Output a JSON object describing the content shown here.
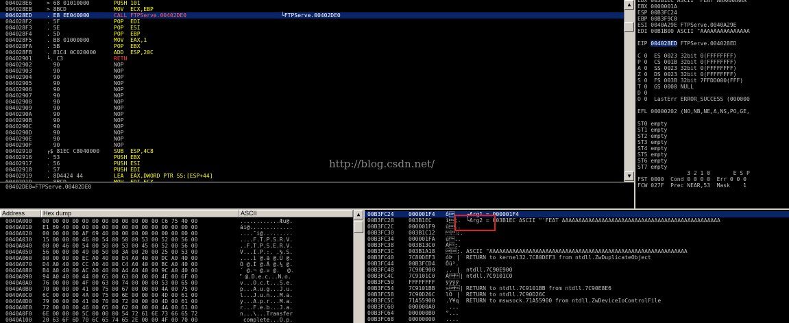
{
  "disassembly": {
    "rows": [
      {
        "addr": "004028E6",
        "gut": " ",
        "hex": "> 68 01010000",
        "op": "PUSH",
        "args": "101",
        "cls": "k-push",
        "cmt": ""
      },
      {
        "addr": "004028EB",
        "gut": " ",
        "hex": "> 8BCD",
        "op": "MOV",
        "args": "ECX,EBP",
        "cls": "k-mov",
        "cmt": ""
      },
      {
        "addr": "004028ED",
        "gut": " ",
        "hex": ". E8 EE040000",
        "op": "CALL",
        "args": "FTPServe.00402DE0",
        "cls": "k-call",
        "cmt": "└FTPServe.00402DE0",
        "sel": true
      },
      {
        "addr": "004028F2",
        "gut": " ",
        "hex": ". 5F",
        "op": "POP",
        "args": "EDI",
        "cls": "k-pop",
        "cmt": ""
      },
      {
        "addr": "004028F3",
        "gut": " ",
        "hex": ". 5E",
        "op": "POP",
        "args": "ESI",
        "cls": "k-pop",
        "cmt": ""
      },
      {
        "addr": "004028F4",
        "gut": " ",
        "hex": ". 5D",
        "op": "POP",
        "args": "EBP",
        "cls": "k-pop",
        "cmt": ""
      },
      {
        "addr": "004028F5",
        "gut": " ",
        "hex": ". B8 01000000",
        "op": "MOV",
        "args": "EAX,1",
        "cls": "k-mov",
        "cmt": ""
      },
      {
        "addr": "004028FA",
        "gut": " ",
        "hex": ". 5B",
        "op": "POP",
        "args": "EBX",
        "cls": "k-pop",
        "cmt": ""
      },
      {
        "addr": "004028FB",
        "gut": " ",
        "hex": ". 81C4 0C020000",
        "op": "ADD",
        "args": "ESP,20C",
        "cls": "k-add",
        "cmt": ""
      },
      {
        "addr": "00402901",
        "gut": " ",
        "hex": "└. C3",
        "op": "RETN",
        "args": "",
        "cls": "k-retn",
        "cmt": ""
      },
      {
        "addr": "00402902",
        "gut": " ",
        "hex": "  90",
        "op": "NOP",
        "args": "",
        "cls": "k-nop",
        "cmt": ""
      },
      {
        "addr": "00402903",
        "gut": " ",
        "hex": "  90",
        "op": "NOP",
        "args": "",
        "cls": "k-nop",
        "cmt": ""
      },
      {
        "addr": "00402904",
        "gut": " ",
        "hex": "  90",
        "op": "NOP",
        "args": "",
        "cls": "k-nop",
        "cmt": ""
      },
      {
        "addr": "00402905",
        "gut": " ",
        "hex": "  90",
        "op": "NOP",
        "args": "",
        "cls": "k-nop",
        "cmt": ""
      },
      {
        "addr": "00402906",
        "gut": " ",
        "hex": "  90",
        "op": "NOP",
        "args": "",
        "cls": "k-nop",
        "cmt": ""
      },
      {
        "addr": "00402907",
        "gut": " ",
        "hex": "  90",
        "op": "NOP",
        "args": "",
        "cls": "k-nop",
        "cmt": ""
      },
      {
        "addr": "00402908",
        "gut": " ",
        "hex": "  90",
        "op": "NOP",
        "args": "",
        "cls": "k-nop",
        "cmt": ""
      },
      {
        "addr": "00402909",
        "gut": " ",
        "hex": "  90",
        "op": "NOP",
        "args": "",
        "cls": "k-nop",
        "cmt": ""
      },
      {
        "addr": "0040290A",
        "gut": " ",
        "hex": "  90",
        "op": "NOP",
        "args": "",
        "cls": "k-nop",
        "cmt": ""
      },
      {
        "addr": "0040290B",
        "gut": " ",
        "hex": "  90",
        "op": "NOP",
        "args": "",
        "cls": "k-nop",
        "cmt": ""
      },
      {
        "addr": "0040290C",
        "gut": " ",
        "hex": "  90",
        "op": "NOP",
        "args": "",
        "cls": "k-nop",
        "cmt": ""
      },
      {
        "addr": "0040290D",
        "gut": " ",
        "hex": "  90",
        "op": "NOP",
        "args": "",
        "cls": "k-nop",
        "cmt": ""
      },
      {
        "addr": "0040290E",
        "gut": " ",
        "hex": "  90",
        "op": "NOP",
        "args": "",
        "cls": "k-nop",
        "cmt": ""
      },
      {
        "addr": "0040290F",
        "gut": " ",
        "hex": "  90",
        "op": "NOP",
        "args": "",
        "cls": "k-nop",
        "cmt": ""
      },
      {
        "addr": "00402910",
        "gut": " ",
        "hex": "┌$ 81EC C8040000",
        "op": "SUB",
        "args": "ESP,4C8",
        "cls": "k-sub",
        "cmt": ""
      },
      {
        "addr": "00402916",
        "gut": " ",
        "hex": ". 53",
        "op": "PUSH",
        "args": "EBX",
        "cls": "k-push",
        "cmt": ""
      },
      {
        "addr": "00402917",
        "gut": " ",
        "hex": ". 56",
        "op": "PUSH",
        "args": "ESI",
        "cls": "k-push",
        "cmt": ""
      },
      {
        "addr": "00402918",
        "gut": " ",
        "hex": ". 57",
        "op": "PUSH",
        "args": "EDI",
        "cls": "k-push",
        "cmt": ""
      },
      {
        "addr": "00402919",
        "gut": " ",
        "hex": ". 8D4424 44",
        "op": "LEA",
        "args": "EAX,DWORD PTR SS:[ESP+44]",
        "cls": "k-lea",
        "cmt": ""
      },
      {
        "addr": "0040291D",
        "gut": " ",
        "hex": ". 8BCD",
        "op": "MOV",
        "args": "EDI,ECX",
        "cls": "k-mov",
        "cmt": ""
      }
    ]
  },
  "info_line": "00402DE0=FTPServe.00402DE0",
  "registers": {
    "lines": [
      {
        "t": "EDX 003B1EC ASCII \"FEAT AAAAAAAAA"
      },
      {
        "t": "EBX 0000001A"
      },
      {
        "t": "ESP 00B3FC24"
      },
      {
        "t": "EBP 00B3F9C0"
      },
      {
        "t": "ESI 0040A29E FTPServe.0040A29E"
      },
      {
        "t": "EDI 00B1B00 ASCII \"AAAAAAAAAAAAAAA"
      },
      {
        "t": ""
      },
      {
        "t": "EIP 004028ED FTPServe.004028ED",
        "hl": "EIP"
      },
      {
        "t": ""
      },
      {
        "t": "C 0  ES 0023 32bit 0(FFFFFFFF)"
      },
      {
        "t": "P 0  CS 001B 32bit 0(FFFFFFFF)"
      },
      {
        "t": "A 0  SS 0023 32bit 0(FFFFFFFF)"
      },
      {
        "t": "Z 0  DS 0023 32bit 0(FFFFFFFF)"
      },
      {
        "t": "S 0  FS 003B 32bit 7FFDD000(FFF)"
      },
      {
        "t": "T 0  GS 0000 NULL"
      },
      {
        "t": "D 0"
      },
      {
        "t": "O 0  LastErr ERROR_SUCCESS (000000"
      },
      {
        "t": ""
      },
      {
        "t": "EFL 00000202 (NO,NB,NE,A,NS,PO,GE,"
      },
      {
        "t": ""
      },
      {
        "t": "ST0 empty"
      },
      {
        "t": "ST1 empty"
      },
      {
        "t": "ST2 empty"
      },
      {
        "t": "ST3 empty"
      },
      {
        "t": "ST4 empty"
      },
      {
        "t": "ST5 empty"
      },
      {
        "t": "ST6 empty"
      },
      {
        "t": "ST7 empty"
      },
      {
        "t": "               3 2 1 0       E S P"
      },
      {
        "t": "FST 0000  Cond 0 0 0 0  Err 0 0 0"
      },
      {
        "t": "FCW 027F  Prec NEAR,53  Mask    1"
      }
    ]
  },
  "dump": {
    "headers": {
      "address": "Address",
      "hex": "Hex dump",
      "ascii": "ASCII"
    },
    "rows": [
      {
        "a": "0040A000",
        "h": "00 00 00 00 00 00 00 00 00 00 00 00 C6 75 40 00",
        "s": "............Æu@."
      },
      {
        "a": "0040A010",
        "h": "E1 69 40 00 00 00 00 00 00 00 00 00 00 00 00 00",
        "s": "ái@............."
      },
      {
        "a": "0040A020",
        "h": "00 00 00 00 AF 69 40 00 00 00 00 00 00 00 00 00",
        "s": "....¯i@........."
      },
      {
        "a": "0040A030",
        "h": "15 00 00 00 46 00 54 00 50 00 53 00 52 00 56 00",
        "s": "....F.T.P.S.R.V."
      },
      {
        "a": "0040A040",
        "h": "00 00 46 00 54 00 50 00 53 00 45 00 52 00 56 00",
        "s": "..F.T.P.S.E.R.V."
      },
      {
        "a": "0040A050",
        "h": "56 00 00 00 49 00 50 00 3A 00 20 00 25 00 53 00",
        "s": "V...I.P.:. .%.S."
      },
      {
        "a": "0040A060",
        "h": "00 00 00 00 EC A0 40 00 E4 A0 40 00 DC A0 40 00",
        "s": "....ì @.ä @.Ü @."
      },
      {
        "a": "0040A070",
        "h": "D4 A0 40 00 CC A0 40 00 C4 A0 40 00 BC A0 40 00",
        "s": "Ô @.Ì @.Ä @.¼ @."
      },
      {
        "a": "0040A080",
        "h": "B4 A0 40 00 AC A0 40 00 A4 A0 40 00 9C A0 40 00",
        "s": "´ @.¬ @.¤ @. @."
      },
      {
        "a": "0040A090",
        "h": "94 A0 40 00 44 00 65 00 63 00 00 00 4E 00 6F 00",
        "s": " @.D.e.c...N.o."
      },
      {
        "a": "0040A0A0",
        "h": "76 00 00 00 4F 00 63 00 74 00 00 00 53 00 65 00",
        "s": "v...O.c.t...S.e."
      },
      {
        "a": "0040A0B0",
        "h": "70 00 00 00 41 00 75 00 67 00 00 00 4A 00 75 00",
        "s": "p...A.u.g...J.u."
      },
      {
        "a": "0040A0C0",
        "h": "6C 00 00 00 4A 00 75 00 6E 00 00 00 4D 00 61 00",
        "s": "l...J.u.n...M.a."
      },
      {
        "a": "0040A0D0",
        "h": "79 00 00 00 41 00 70 00 72 00 00 00 4D 00 61 00",
        "s": "y...A.p.r...M.a."
      },
      {
        "a": "0040A0E0",
        "h": "72 00 00 00 46 00 65 00 62 00 00 00 4A 00 61 00",
        "s": "r...F.e.b...J.a."
      },
      {
        "a": "0040A0F0",
        "h": "6E 00 00 00 5C 00 00 00 54 72 61 6E 73 66 65 72",
        "s": "n...\\...Transfer"
      },
      {
        "a": "0040A100",
        "h": "20 63 6F 6D 70 6C 65 74 65 2E 00 00 4F 00 70 00",
        "s": " complete...O.p."
      }
    ]
  },
  "stack": {
    "rows": [
      {
        "addr": "00B3FC24",
        "val": "000001F4",
        "asc": "ô\u0001..",
        "cmt": "┌Arg1 = 000001F4",
        "sel": true
      },
      {
        "addr": "00B3FC28",
        "val": "003B1EC",
        "asc": "ì\u001b;.",
        "cmt": "└Arg2 = 003B1EC ASCII \"'FEAT AAAAAAAAAAAAAAAAAAAAAAAAAAAAAAAAAAAAAAAAAAAAAAAA"
      },
      {
        "addr": "00B3FC2C",
        "val": "000001F9",
        "asc": "ù\u0001..",
        "cmt": ""
      },
      {
        "addr": "00B3FC30",
        "val": "003B1C12",
        "asc": "\u0012\u001c;.",
        "cmt": ""
      },
      {
        "addr": "00B3FC34",
        "val": "000001FA",
        "asc": "ú\u0001..",
        "cmt": ""
      },
      {
        "addr": "00B3FC38",
        "val": "003B13C0",
        "asc": "À\u0013;.",
        "cmt": ""
      },
      {
        "addr": "00B3FC3C",
        "val": "003B1A18",
        "asc": "\u0018\u001a;.",
        "cmt": "ASCII \"AAAAAAAAAAAAAAAAAAAAAAAAAAAAAAAAAAAAAAAAAAAAAAAAAAAAAAAAAAAA"
      },
      {
        "addr": "00B3FC40",
        "val": "7C80DEF3",
        "asc": "óÞ|",
        "cmt": "RETURN to kernel32.7C80DEF3 from ntdll.ZwDuplicateObject"
      },
      {
        "addr": "00B3FC44",
        "val": "00B3FCD4",
        "asc": "Ôü³.",
        "cmt": ""
      },
      {
        "addr": "00B3FC48",
        "val": "7C90E900",
        "asc": "..|",
        "cmt": "ntdll.7C90E900"
      },
      {
        "addr": "00B3FC4C",
        "val": "7C9101C0",
        "asc": "À\u0001|",
        "cmt": "ntdll.7C9101C0"
      },
      {
        "addr": "00B3FC50",
        "val": "FFFFFFFF",
        "asc": "ÿÿÿÿ",
        "cmt": ""
      },
      {
        "addr": "00B3FC54",
        "val": "7C9101BB",
        "asc": "»\u0001|",
        "cmt": "RETURN to ntdll.7C9101BB from ntdll.7C90E8E6"
      },
      {
        "addr": "00B3FC58",
        "val": "7C90D26C",
        "asc": "lÒ|",
        "cmt": "RETURN to ntdll.7C90D26C"
      },
      {
        "addr": "00B3FC5C",
        "val": "71A55900",
        "asc": ".Y¥q",
        "cmt": "RETURN to mswsock.71A55900 from ntdll.ZwDeviceIoControlFile"
      },
      {
        "addr": "00B3FC60",
        "val": "000000A0",
        "asc": " ...",
        "cmt": ""
      },
      {
        "addr": "00B3FC64",
        "val": "000000B0",
        "asc": "°...",
        "cmt": ""
      },
      {
        "addr": "00B3FC68",
        "val": "00000000",
        "asc": "....",
        "cmt": ""
      }
    ]
  },
  "watermark": "http://blog.csdn.net/",
  "colors": {
    "selection": "#0a246a",
    "pane_bg": "#000000",
    "chrome": "#d4d0c8",
    "highlight_box": "#e02020"
  }
}
